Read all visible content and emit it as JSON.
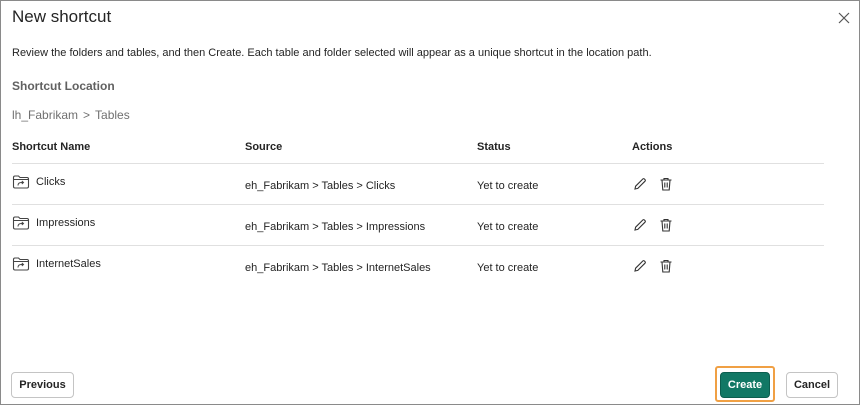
{
  "dialog": {
    "title": "New shortcut",
    "description": "Review the folders and tables, and then Create. Each table and folder selected will appear as a unique shortcut in the location path.",
    "location_label": "Shortcut Location",
    "location_path": [
      "lh_Fabrikam",
      "Tables"
    ],
    "path_separator": ">"
  },
  "table": {
    "headers": {
      "name": "Shortcut Name",
      "source": "Source",
      "status": "Status",
      "actions": "Actions"
    },
    "rows": [
      {
        "name": "Clicks",
        "source": "eh_Fabrikam > Tables > Clicks",
        "status": "Yet to create"
      },
      {
        "name": "Impressions",
        "source": "eh_Fabrikam > Tables > Impressions",
        "status": "Yet to create"
      },
      {
        "name": "InternetSales",
        "source": "eh_Fabrikam > Tables > InternetSales",
        "status": "Yet to create"
      }
    ]
  },
  "footer": {
    "previous_label": "Previous",
    "create_label": "Create",
    "cancel_label": "Cancel"
  },
  "colors": {
    "primary": "#117865",
    "highlight": "#f0a044"
  },
  "icons": {
    "close": "close-icon",
    "row": "folder-shortcut-icon",
    "edit": "pencil-icon",
    "delete": "trash-icon"
  }
}
